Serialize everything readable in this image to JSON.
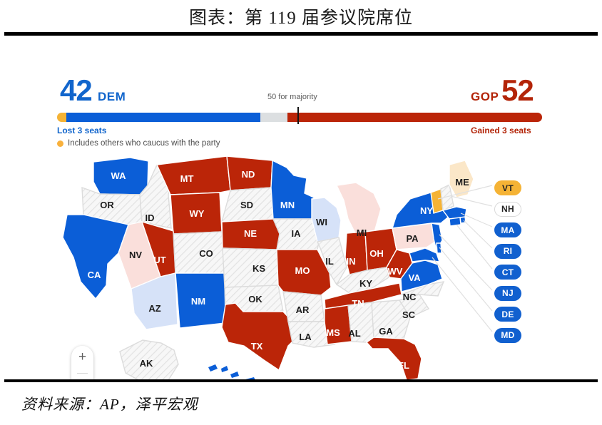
{
  "title": "图表：第 119 届参议院席位",
  "footer": "资料来源：AP，泽平宏观",
  "seat_bar": {
    "dem_count": "42",
    "dem_label": "DEM",
    "gop_count": "52",
    "gop_label": "GOP",
    "majority_note": "50 for majority",
    "dem_change": "Lost 3 seats",
    "gop_change": "Gained 3 seats",
    "legend_note": "Includes others who caucus with the party"
  },
  "colors": {
    "dem": "#0b5ed7",
    "gop": "#bb2508",
    "dem_light": "#d6e2f8",
    "gop_light": "#fadfdb",
    "independent": "#f5b335",
    "ind_light": "#fbe7c8",
    "no_race": "#f6f6f6",
    "dem_text": "#1165cc",
    "gop_text": "#b32408",
    "divider": "#000000"
  },
  "zoom_control": {
    "in": "+",
    "out": "−"
  },
  "pills": [
    {
      "code": "VT",
      "party": "ind"
    },
    {
      "code": "NH",
      "party": "none"
    },
    {
      "code": "MA",
      "party": "dem"
    },
    {
      "code": "RI",
      "party": "dem"
    },
    {
      "code": "CT",
      "party": "dem"
    },
    {
      "code": "NJ",
      "party": "dem"
    },
    {
      "code": "DE",
      "party": "dem"
    },
    {
      "code": "MD",
      "party": "dem"
    }
  ],
  "chart_data": {
    "type": "map",
    "title": "第 119 届参议院席位",
    "legend": [
      "DEM",
      "GOP",
      "Includes others who caucus with the party"
    ],
    "totals": {
      "DEM": 42,
      "GOP": 52,
      "majority": 50
    },
    "states": [
      {
        "code": "WA",
        "party": "dem",
        "label_color": "white"
      },
      {
        "code": "OR",
        "party": "no_race",
        "label_color": "dark"
      },
      {
        "code": "CA",
        "party": "dem",
        "label_color": "white"
      },
      {
        "code": "NV",
        "party": "gop_light",
        "label_color": "dark"
      },
      {
        "code": "ID",
        "party": "no_race",
        "label_color": "dark"
      },
      {
        "code": "MT",
        "party": "gop",
        "label_color": "white"
      },
      {
        "code": "WY",
        "party": "gop",
        "label_color": "white"
      },
      {
        "code": "UT",
        "party": "gop",
        "label_color": "white"
      },
      {
        "code": "AZ",
        "party": "dem_light",
        "label_color": "dark"
      },
      {
        "code": "NM",
        "party": "dem",
        "label_color": "white"
      },
      {
        "code": "CO",
        "party": "no_race",
        "label_color": "dark"
      },
      {
        "code": "ND",
        "party": "gop",
        "label_color": "white"
      },
      {
        "code": "SD",
        "party": "no_race",
        "label_color": "dark"
      },
      {
        "code": "NE",
        "party": "gop",
        "label_color": "white"
      },
      {
        "code": "KS",
        "party": "no_race",
        "label_color": "dark"
      },
      {
        "code": "OK",
        "party": "no_race",
        "label_color": "dark"
      },
      {
        "code": "TX",
        "party": "gop",
        "label_color": "white"
      },
      {
        "code": "MN",
        "party": "dem",
        "label_color": "white"
      },
      {
        "code": "IA",
        "party": "no_race",
        "label_color": "dark"
      },
      {
        "code": "MO",
        "party": "gop",
        "label_color": "white"
      },
      {
        "code": "AR",
        "party": "no_race",
        "label_color": "dark"
      },
      {
        "code": "LA",
        "party": "no_race",
        "label_color": "dark"
      },
      {
        "code": "WI",
        "party": "dem_light",
        "label_color": "dark"
      },
      {
        "code": "IL",
        "party": "no_race",
        "label_color": "dark"
      },
      {
        "code": "MS",
        "party": "gop",
        "label_color": "white"
      },
      {
        "code": "MI",
        "party": "gop_light",
        "label_color": "dark"
      },
      {
        "code": "IN",
        "party": "gop",
        "label_color": "white"
      },
      {
        "code": "OH",
        "party": "gop",
        "label_color": "white"
      },
      {
        "code": "KY",
        "party": "no_race",
        "label_color": "dark"
      },
      {
        "code": "TN",
        "party": "gop",
        "label_color": "white"
      },
      {
        "code": "AL",
        "party": "no_race",
        "label_color": "dark"
      },
      {
        "code": "GA",
        "party": "no_race",
        "label_color": "dark"
      },
      {
        "code": "FL",
        "party": "gop",
        "label_color": "white"
      },
      {
        "code": "SC",
        "party": "no_race",
        "label_color": "dark"
      },
      {
        "code": "NC",
        "party": "no_race",
        "label_color": "dark"
      },
      {
        "code": "WV",
        "party": "gop",
        "label_color": "white"
      },
      {
        "code": "VA",
        "party": "dem",
        "label_color": "white"
      },
      {
        "code": "PA",
        "party": "gop_light",
        "label_color": "dark"
      },
      {
        "code": "NY",
        "party": "dem",
        "label_color": "white"
      },
      {
        "code": "ME",
        "party": "ind_light",
        "label_color": "dark"
      },
      {
        "code": "VT",
        "party": "ind",
        "label_color": "dark"
      },
      {
        "code": "NH",
        "party": "no_race",
        "label_color": "dark"
      },
      {
        "code": "MA",
        "party": "dem",
        "label_color": "white"
      },
      {
        "code": "RI",
        "party": "dem",
        "label_color": "white"
      },
      {
        "code": "CT",
        "party": "dem",
        "label_color": "white"
      },
      {
        "code": "NJ",
        "party": "dem",
        "label_color": "white"
      },
      {
        "code": "DE",
        "party": "dem",
        "label_color": "white"
      },
      {
        "code": "MD",
        "party": "dem",
        "label_color": "white"
      },
      {
        "code": "AK",
        "party": "no_race",
        "label_color": "dark"
      },
      {
        "code": "HI",
        "party": "dem",
        "label_color": "dark"
      }
    ]
  }
}
